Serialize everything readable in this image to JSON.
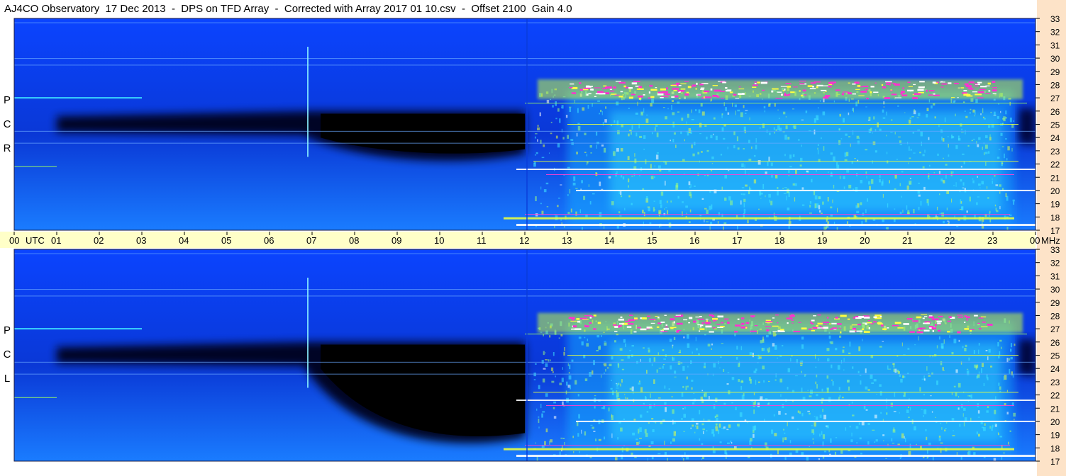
{
  "title": "AJ4CO Observatory  17 Dec 2013  -  DPS on TFD Array  -  Corrected with Array 2017 01 10.csv  -  Offset 2100  Gain 4.0",
  "colors": {
    "background": "#ffffff",
    "time_axis_band": "#ffffc8",
    "freq_axis_strip": "#fde3c8",
    "deep_blue": "#0a3ad8",
    "black": "#000000",
    "cyan": "#20d8ff",
    "yellow_green": "#d8ff40",
    "magenta": "#ff30d0",
    "white": "#ffffff"
  },
  "chart_data": [
    {
      "type": "heatmap",
      "panel": "top",
      "ylabel_letters": [
        "R",
        "C",
        "P"
      ],
      "y_ticks": [
        "17",
        "18",
        "19",
        "20",
        "21",
        "22",
        "23",
        "24",
        "25",
        "26",
        "27",
        "28",
        "29",
        "30",
        "31",
        "32",
        "33"
      ],
      "ylim": [
        17,
        33
      ],
      "yunit": "MHz",
      "x_ticks": [
        "00",
        "01",
        "02",
        "03",
        "04",
        "05",
        "06",
        "07",
        "08",
        "09",
        "10",
        "11",
        "12",
        "13",
        "14",
        "15",
        "16",
        "17",
        "18",
        "19",
        "20",
        "21",
        "22",
        "23",
        "00"
      ],
      "xunit": "UTC",
      "xlim": [
        0,
        24
      ]
    },
    {
      "type": "heatmap",
      "panel": "bottom",
      "ylabel_letters": [
        "L",
        "C",
        "P"
      ],
      "y_ticks": [
        "17",
        "18",
        "19",
        "20",
        "21",
        "22",
        "23",
        "24",
        "25",
        "26",
        "27",
        "28",
        "29",
        "30",
        "31",
        "32",
        "33"
      ],
      "ylim": [
        17,
        33
      ],
      "yunit": "MHz",
      "x_ticks": [
        "00",
        "01",
        "02",
        "03",
        "04",
        "05",
        "06",
        "07",
        "08",
        "09",
        "10",
        "11",
        "12",
        "13",
        "14",
        "15",
        "16",
        "17",
        "18",
        "19",
        "20",
        "21",
        "22",
        "23",
        "00"
      ],
      "xunit": "UTC",
      "xlim": [
        0,
        24
      ]
    }
  ],
  "axis_labels": {
    "utc": "UTC",
    "mhz": "MHz"
  }
}
